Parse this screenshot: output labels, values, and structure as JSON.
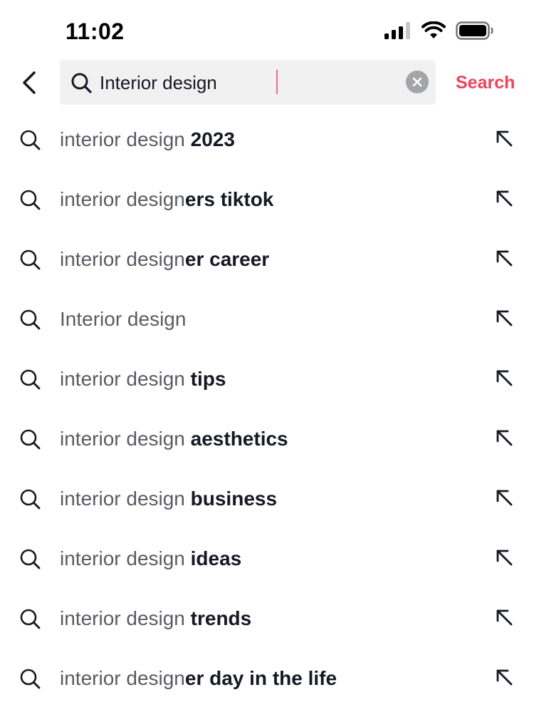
{
  "status_bar": {
    "time": "11:02",
    "icons": [
      "cellular-signal-icon",
      "wifi-icon",
      "battery-icon"
    ]
  },
  "search": {
    "query": "Interior design",
    "submit_label": "Search",
    "accent_color": "#ea445a",
    "icons": {
      "back": "chevron-left-icon",
      "search": "search-icon",
      "clear": "clear-icon"
    }
  },
  "suggestions": [
    {
      "typed": "interior design",
      "completion": " 2023"
    },
    {
      "typed": "interior design",
      "completion": "ers tiktok"
    },
    {
      "typed": "interior design",
      "completion": "er career"
    },
    {
      "typed": "Interior design",
      "completion": ""
    },
    {
      "typed": "interior design",
      "completion": " tips"
    },
    {
      "typed": "interior design",
      "completion": " aesthetics"
    },
    {
      "typed": "interior design",
      "completion": " business"
    },
    {
      "typed": "interior design",
      "completion": " ideas"
    },
    {
      "typed": "interior design",
      "completion": " trends"
    },
    {
      "typed": "interior design",
      "completion": "er day in the life"
    }
  ]
}
